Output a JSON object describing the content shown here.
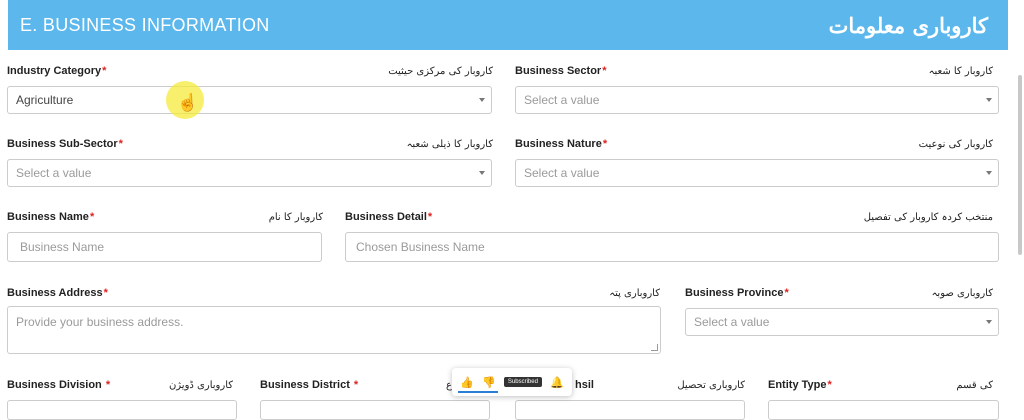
{
  "section": {
    "title": "E. BUSINESS INFORMATION",
    "title_urdu": "کاروباری معلومات"
  },
  "fields": {
    "industry_category": {
      "label": "Industry Category",
      "urdu": "کاروبار کی مرکزی حیثیت",
      "value": "Agriculture"
    },
    "business_sector": {
      "label": "Business Sector",
      "urdu": "کاروبار کا شعبہ",
      "placeholder": "Select a value"
    },
    "business_sub_sector": {
      "label": "Business Sub-Sector",
      "urdu": "کاروبار کا ذیلی شعبہ",
      "placeholder": "Select a value"
    },
    "business_nature": {
      "label": "Business Nature",
      "urdu": "کاروبار کی نوعیت",
      "placeholder": "Select a value"
    },
    "business_name": {
      "label": "Business Name",
      "urdu": "کاروبار کا نام",
      "placeholder": "Business Name"
    },
    "business_detail": {
      "label": "Business Detail",
      "urdu": "منتخب کردہ کاروبار کی تفصیل",
      "placeholder": "Chosen Business Name"
    },
    "business_address": {
      "label": "Business Address",
      "urdu": "کاروباری پتہ",
      "placeholder": "Provide your business  address."
    },
    "business_province": {
      "label": "Business Province",
      "urdu": "کاروباری صوبہ",
      "placeholder": "Select a value"
    },
    "business_division": {
      "label": "Business Division ",
      "urdu": "کاروباری ڈویژن"
    },
    "business_district": {
      "label": "Business District ",
      "urdu": "ع"
    },
    "business_tehsil": {
      "label": "hsil",
      "urdu": "کاروباری تحصیل"
    },
    "entity_type": {
      "label": "Entity Type",
      "urdu": "کی قسم"
    }
  },
  "required_marker": "*",
  "overlay": {
    "subscribed_label": "Subscribed"
  }
}
